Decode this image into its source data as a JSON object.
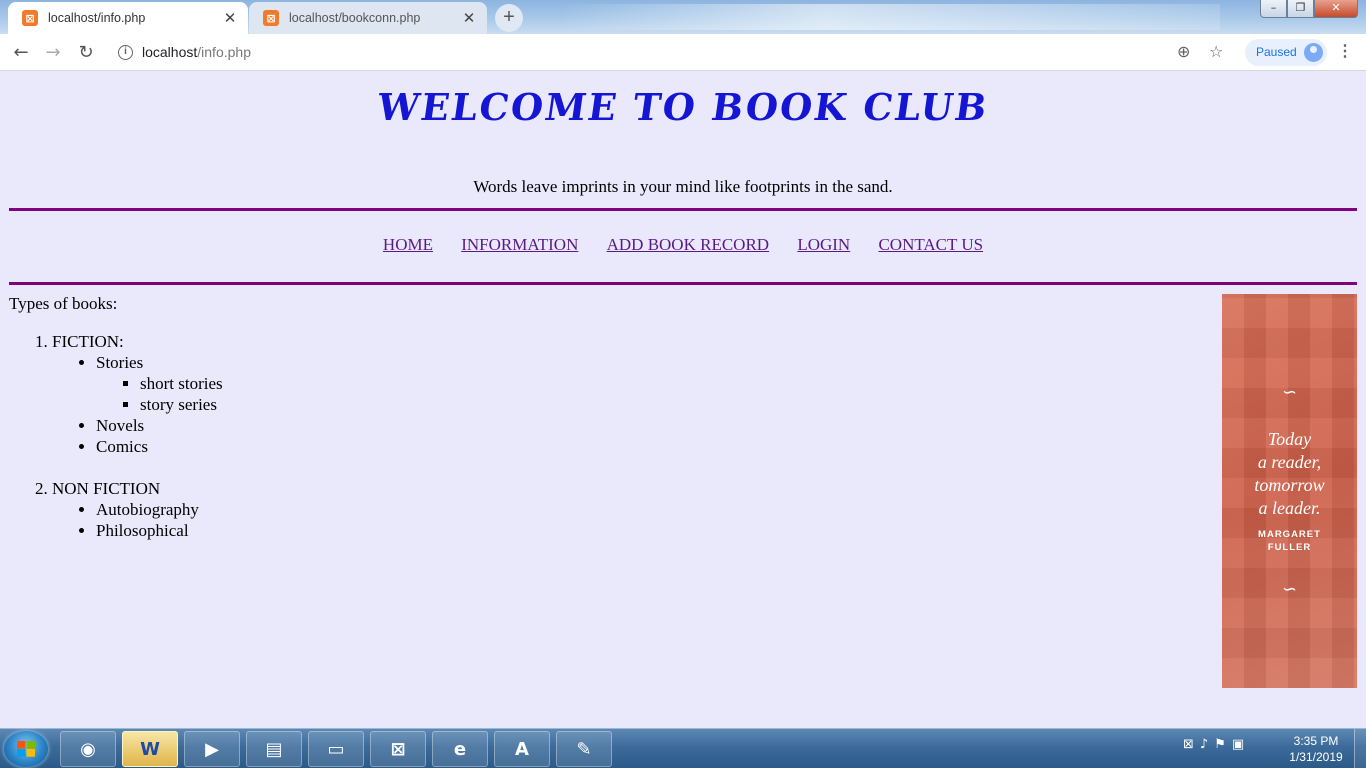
{
  "browser": {
    "tabs": [
      {
        "title": "localhost/info.php",
        "active": true,
        "favicon": "xampp-icon"
      },
      {
        "title": "localhost/bookconn.php",
        "active": false,
        "favicon": "xampp-icon"
      }
    ],
    "url_host": "localhost",
    "url_path": "/info.php",
    "profile_status": "Paused"
  },
  "site": {
    "title": "WELCOME TO BOOK CLUB",
    "tagline": "Words leave imprints in your mind like footprints in the sand.",
    "nav": [
      "HOME",
      "INFORMATION",
      "ADD BOOK RECORD",
      "LOGIN",
      "CONTACT US"
    ],
    "colors": {
      "title": "#1515d4",
      "rule": "#800080",
      "link": "#5a1a86",
      "background": "#e9e9fb"
    }
  },
  "content": {
    "heading": "Types of books:",
    "categories": [
      {
        "label": "FICTION:",
        "items": [
          {
            "label": "Stories",
            "sub": [
              "short stories",
              "story series"
            ]
          },
          {
            "label": "Novels"
          },
          {
            "label": "Comics"
          }
        ]
      },
      {
        "label": "NON FICTION",
        "items": [
          {
            "label": "Autobiography"
          },
          {
            "label": "Philosophical"
          }
        ]
      }
    ]
  },
  "ad": {
    "quote": [
      "Today",
      "a reader,",
      "tomorrow",
      "a leader."
    ],
    "author": [
      "MARGARET",
      "FULLER"
    ]
  },
  "taskbar": {
    "apps": [
      "chrome-icon",
      "word-icon",
      "media-player-icon",
      "notepad-icon",
      "file-explorer-icon",
      "xampp-icon",
      "internet-explorer-icon",
      "wordpad-icon",
      "paint-icon"
    ],
    "time": "3:35 PM",
    "date": "1/31/2019"
  }
}
